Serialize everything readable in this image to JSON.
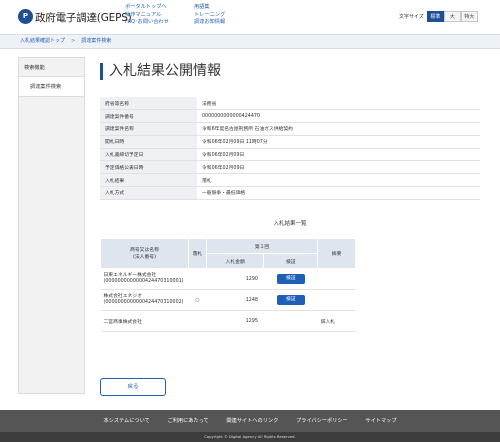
{
  "header": {
    "logo_glyph": "P",
    "site_name": "政府電子調達(GEPS)",
    "links_col1": [
      "ポータルトップへ",
      "操作マニュアル",
      "FAQ･お問い合わせ"
    ],
    "links_col2": [
      "用語集",
      "トレーニング",
      "調達お知情報"
    ],
    "font_size_label": "文字サイズ",
    "font_sizes": [
      "標準",
      "大",
      "特大"
    ],
    "font_size_selected": "標準"
  },
  "breadcrumb": {
    "items": [
      "入札結果確認トップ",
      "調達案件検索"
    ],
    "separator": ">"
  },
  "sidebar": {
    "title": "検索機能",
    "items": [
      "調達案件検索"
    ]
  },
  "main": {
    "title": "入札結果公開情報",
    "info_rows": [
      {
        "label": "府省等名称",
        "value": "法務省"
      },
      {
        "label": "調達案件番号",
        "value": "0000000000000424470"
      },
      {
        "label": "調達案件名称",
        "value": "令和6年度名古屋刑務所 石油ガス供給契約"
      },
      {
        "label": "開札日時",
        "value": "令和06年02月09日 11時07分"
      },
      {
        "label": "入札書締切予定日",
        "value": "令和06年02月09日"
      },
      {
        "label": "予定価格公表日時",
        "value": "令和06年02月09日"
      },
      {
        "label": "入札結果",
        "value": "落札"
      },
      {
        "label": "入札方式",
        "value": "一般競争・最低価格"
      }
    ],
    "results_caption": "入札結果一覧",
    "results_headers": {
      "company": "商号又は名称\n(法人番号)",
      "winner": "落札",
      "round": "第１回",
      "amount": "入札金額",
      "detail": "検証",
      "remarks": "摘要"
    },
    "results_rows": [
      {
        "company": "日東エネルギー株式会社\n(0000000000000424470310001)",
        "winner": "",
        "amount": "1290",
        "detail": "検証",
        "remarks": ""
      },
      {
        "company": "株式会社エネジオ\n(0000000000000424470310002)",
        "winner": "○",
        "amount": "1248",
        "detail": "検証",
        "remarks": ""
      },
      {
        "company": "二宮商事株式会社",
        "winner": "",
        "amount": "1295",
        "detail": "",
        "remarks": "辞入札"
      }
    ],
    "back_label": "戻る"
  },
  "footer": {
    "links": [
      "本システムについて",
      "ご利用にあたって",
      "関連サイトへのリンク",
      "プライバシーポリシー",
      "サイトマップ"
    ],
    "copyright": "Copyright © Digital Agency All Rights Reserved."
  },
  "colors": {
    "primary": "#1e4e96",
    "link": "#1f5fb8",
    "footer_bg": "#555555"
  }
}
